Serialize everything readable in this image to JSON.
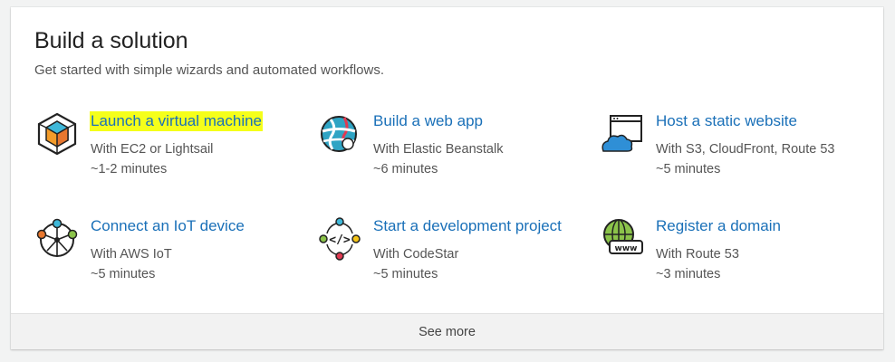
{
  "panel": {
    "title": "Build a solution",
    "subtitle": "Get started with simple wizards and automated workflows."
  },
  "tiles": [
    {
      "icon": "virtual-machine-icon",
      "title": "Launch a virtual machine",
      "detail": "With EC2 or Lightsail",
      "time": "~1-2 minutes",
      "highlighted": true
    },
    {
      "icon": "web-app-icon",
      "title": "Build a web app",
      "detail": "With Elastic Beanstalk",
      "time": "~6 minutes"
    },
    {
      "icon": "static-website-icon",
      "title": "Host a static website",
      "detail": "With S3, CloudFront, Route 53",
      "time": "~5 minutes"
    },
    {
      "icon": "iot-device-icon",
      "title": "Connect an IoT device",
      "detail": "With AWS IoT",
      "time": "~5 minutes"
    },
    {
      "icon": "development-project-icon",
      "title": "Start a development project",
      "detail": "With CodeStar",
      "time": "~5 minutes"
    },
    {
      "icon": "domain-icon",
      "title": "Register a domain",
      "detail": "With Route 53",
      "time": "~3 minutes"
    }
  ],
  "footer": {
    "label": "See more"
  },
  "colors": {
    "link": "#1a70b8",
    "highlight": "#f5ff1a",
    "background": "#f2f3f3",
    "panel": "#ffffff"
  }
}
